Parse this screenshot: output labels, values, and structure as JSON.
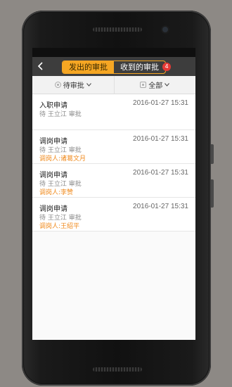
{
  "header": {
    "tabs": [
      {
        "label": "发出的审批",
        "active": true
      },
      {
        "label": "收到的审批",
        "active": false
      }
    ],
    "badge_count": "4"
  },
  "filters": [
    {
      "label": "待审批",
      "icon": "status-icon"
    },
    {
      "label": "全部",
      "icon": "category-icon"
    }
  ],
  "items": [
    {
      "title": "入职申请",
      "time": "2016-01-27 15:31",
      "subtitle": "待 王立江 审批",
      "extra": ""
    },
    {
      "title": "调岗申请",
      "time": "2016-01-27 15:31",
      "subtitle": "待 王立江 审批",
      "extra": "调岗人:诸葛文月"
    },
    {
      "title": "调岗申请",
      "time": "2016-01-27 15:31",
      "subtitle": "待 王立江 审批",
      "extra": "调岗人:李赞"
    },
    {
      "title": "调岗申请",
      "time": "2016-01-27 15:31",
      "subtitle": "待 王立江 审批",
      "extra": "调岗人:王绍平"
    }
  ],
  "colors": {
    "accent": "#f5a623",
    "badge": "#e53935",
    "extra_text": "#f08a1c",
    "navbar": "#3d3d3d"
  }
}
